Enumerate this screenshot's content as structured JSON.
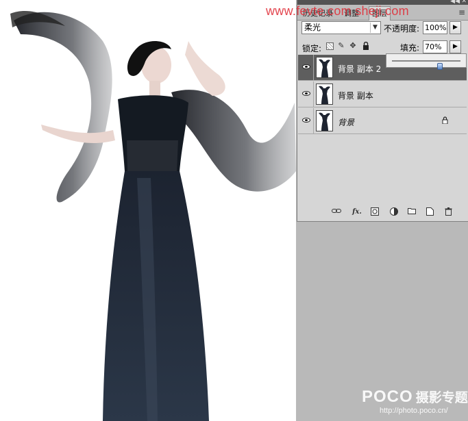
{
  "watermark": {
    "top_url": "www.fevte.com  sheji.com",
    "brand": "POCO",
    "title": "摄影专题",
    "url": "http://photo.poco.cn/"
  },
  "panel": {
    "tabs": [
      {
        "label": "历史记录"
      },
      {
        "label": "调整"
      },
      {
        "label": "图层"
      }
    ],
    "blend_mode": "柔光",
    "opacity_label": "不透明度:",
    "opacity_value": "100%",
    "lock_label": "锁定:",
    "fill_label": "填充:",
    "fill_value": "70%",
    "fill_slider_level": 0.7,
    "layers": [
      {
        "name": "背景 副本 2",
        "selected": true,
        "visible": true,
        "locked": false
      },
      {
        "name": "背景 副本",
        "selected": false,
        "visible": true,
        "locked": false
      },
      {
        "name": "背景",
        "selected": false,
        "visible": true,
        "locked": true
      }
    ]
  },
  "icons": {
    "panel_menu": "panel-menu-icon",
    "link": "link-layers-icon",
    "fx": "fx-icon",
    "mask": "add-mask-icon",
    "adjustment": "adjustment-layer-icon",
    "group": "folder-icon",
    "new_layer": "new-layer-icon",
    "trash": "trash-icon"
  },
  "colors": {
    "panel_bg": "#d6d6d6",
    "selected_row": "#5e5e5e",
    "watermark_red": "#e0303a",
    "workspace": "#b9b9b9"
  }
}
